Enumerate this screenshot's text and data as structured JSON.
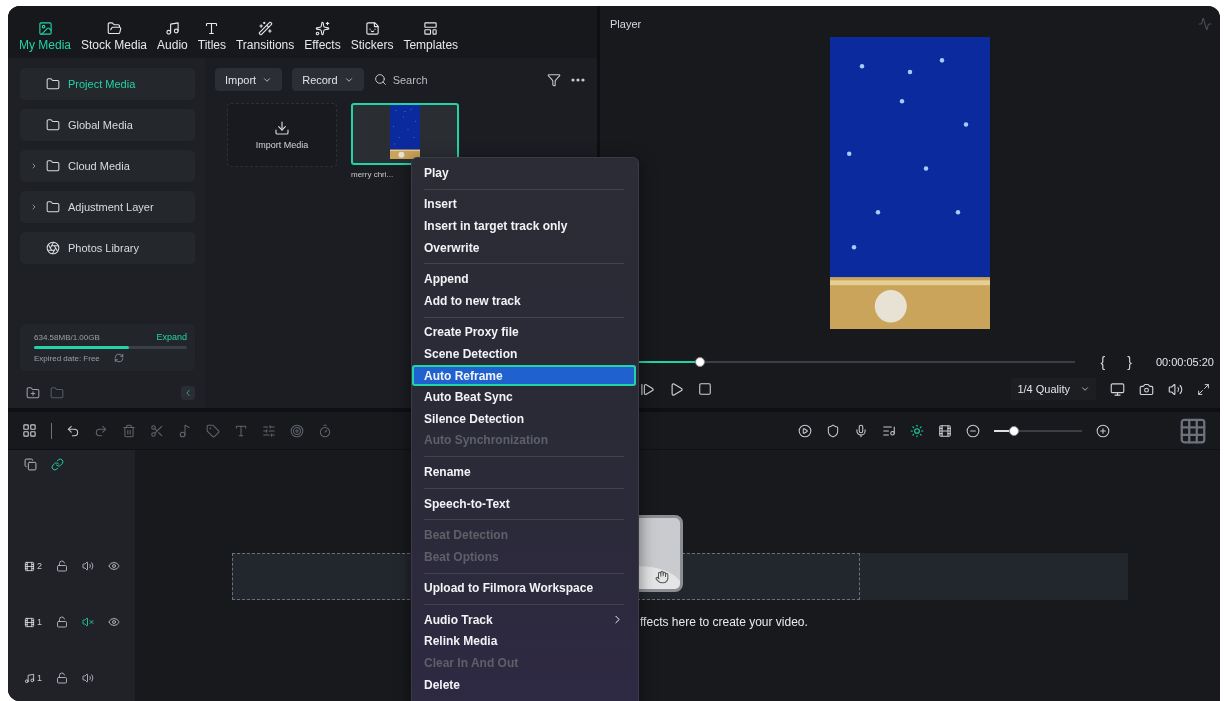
{
  "top_tabs": [
    {
      "label": "My Media",
      "selected": true
    },
    {
      "label": "Stock Media",
      "selected": false
    },
    {
      "label": "Audio",
      "selected": false
    },
    {
      "label": "Titles",
      "selected": false
    },
    {
      "label": "Transitions",
      "selected": false
    },
    {
      "label": "Effects",
      "selected": false
    },
    {
      "label": "Stickers",
      "selected": false
    },
    {
      "label": "Templates",
      "selected": false
    }
  ],
  "sidebar": {
    "items": [
      {
        "kind": "folder",
        "label": "Project Media",
        "selected": true
      },
      {
        "kind": "folder",
        "label": "Global Media",
        "selected": false
      },
      {
        "kind": "folder_group",
        "label": "Cloud Media",
        "selected": false
      },
      {
        "kind": "folder_group",
        "label": "Adjustment Layer",
        "selected": false
      },
      {
        "kind": "library",
        "label": "Photos Library",
        "selected": false
      }
    ],
    "storage": {
      "usage": "634.58MB/1.00GB",
      "action": "Expand",
      "level": 0.62,
      "expiry": "Expired date: Free"
    }
  },
  "media_toolbar": {
    "import": "Import",
    "record": "Record",
    "search": {
      "placeholder": "Search"
    }
  },
  "media_items": [
    {
      "kind": "import",
      "label": "Import Media"
    },
    {
      "kind": "clip",
      "label": "merry chri...",
      "selected": true
    }
  ],
  "player": {
    "title": "Player",
    "progress": {
      "level": 0.21
    },
    "mark_in": "{",
    "mark_out": "}",
    "timecode": "00:00:05:20",
    "quality": "1/4 Quality"
  },
  "timeline": {
    "zoom": {
      "level": 0.23
    },
    "link_on": true,
    "tracks": [
      {
        "kind": "video",
        "number": "2",
        "muted": false
      },
      {
        "kind": "video",
        "number": "1",
        "muted": true
      },
      {
        "kind": "audio",
        "number": "1",
        "muted": false
      }
    ],
    "hint": "ffects here to create your video."
  },
  "context_menu": {
    "groups": [
      [
        {
          "label": "Play",
          "disabled": false,
          "selected": false,
          "submenu": false
        }
      ],
      [
        {
          "label": "Insert",
          "disabled": false,
          "selected": false,
          "submenu": false
        },
        {
          "label": "Insert in target track only",
          "disabled": false,
          "selected": false,
          "submenu": false
        },
        {
          "label": "Overwrite",
          "disabled": false,
          "selected": false,
          "submenu": false
        }
      ],
      [
        {
          "label": "Append",
          "disabled": false,
          "selected": false,
          "submenu": false
        },
        {
          "label": "Add to new track",
          "disabled": false,
          "selected": false,
          "submenu": false
        }
      ],
      [
        {
          "label": "Create Proxy file",
          "disabled": false,
          "selected": false,
          "submenu": false
        },
        {
          "label": "Scene Detection",
          "disabled": false,
          "selected": false,
          "submenu": false
        },
        {
          "label": "Auto Reframe",
          "disabled": false,
          "selected": true,
          "submenu": false
        },
        {
          "label": "Auto Beat Sync",
          "disabled": false,
          "selected": false,
          "submenu": false
        },
        {
          "label": "Silence Detection",
          "disabled": false,
          "selected": false,
          "submenu": false
        },
        {
          "label": "Auto Synchronization",
          "disabled": true,
          "selected": false,
          "submenu": false
        }
      ],
      [
        {
          "label": "Rename",
          "disabled": false,
          "selected": false,
          "submenu": false
        }
      ],
      [
        {
          "label": "Speech-to-Text",
          "disabled": false,
          "selected": false,
          "submenu": false
        }
      ],
      [
        {
          "label": "Beat Detection",
          "disabled": true,
          "selected": false,
          "submenu": false
        },
        {
          "label": "Beat Options",
          "disabled": true,
          "selected": false,
          "submenu": false
        }
      ],
      [
        {
          "label": "Upload to Filmora Workspace",
          "disabled": false,
          "selected": false,
          "submenu": false
        }
      ],
      [
        {
          "label": "Audio Track",
          "disabled": false,
          "selected": false,
          "submenu": true
        },
        {
          "label": "Relink Media",
          "disabled": false,
          "selected": false,
          "submenu": false
        },
        {
          "label": "Clear In And Out",
          "disabled": true,
          "selected": false,
          "submenu": false
        },
        {
          "label": "Delete",
          "disabled": false,
          "selected": false,
          "submenu": false
        }
      ]
    ]
  }
}
